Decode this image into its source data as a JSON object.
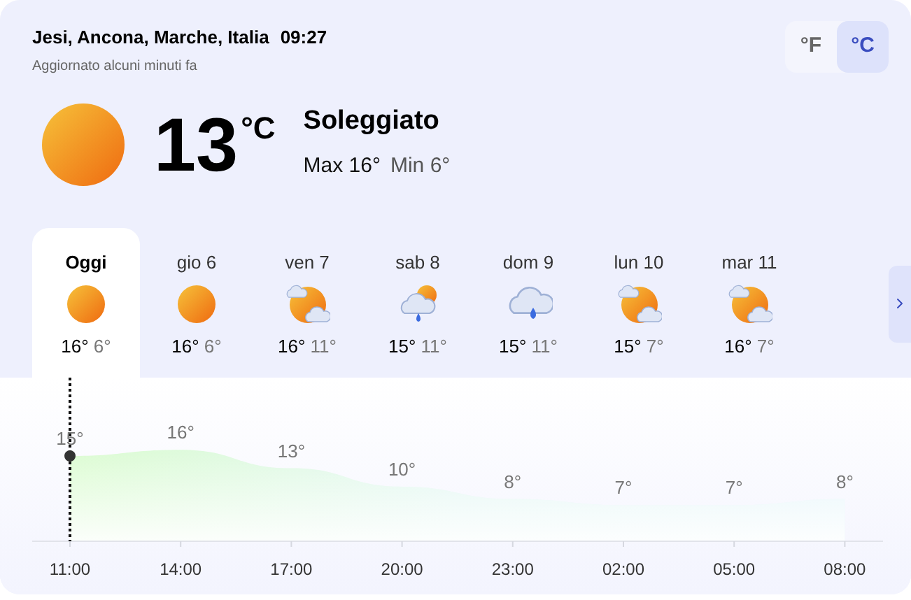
{
  "header": {
    "location": "Jesi, Ancona, Marche, Italia",
    "time": "09:27",
    "updated": "Aggiornato alcuni minuti fa"
  },
  "units": [
    {
      "label": "°F",
      "selected": false
    },
    {
      "label": "°C",
      "selected": true
    }
  ],
  "current": {
    "kind": "sun",
    "temperature": "13",
    "unit": "°C",
    "condition": "Soleggiato",
    "max_label": "Max",
    "max": "16°",
    "min_label": "Min",
    "min": "6°"
  },
  "days": [
    {
      "label": "Oggi",
      "kind": "sun",
      "high": "16°",
      "low": "6°",
      "selected": true
    },
    {
      "label": "gio 6",
      "kind": "sun",
      "high": "16°",
      "low": "6°",
      "selected": false
    },
    {
      "label": "ven 7",
      "kind": "sun-cloud",
      "high": "16°",
      "low": "11°",
      "selected": false
    },
    {
      "label": "sab 8",
      "kind": "rain-sun",
      "high": "15°",
      "low": "11°",
      "selected": false
    },
    {
      "label": "dom 9",
      "kind": "rain",
      "high": "15°",
      "low": "11°",
      "selected": false
    },
    {
      "label": "lun 10",
      "kind": "sun-cloud",
      "high": "15°",
      "low": "7°",
      "selected": false
    },
    {
      "label": "mar 11",
      "kind": "sun-cloud",
      "high": "16°",
      "low": "7°",
      "selected": false
    }
  ],
  "hourly": {
    "chart_data": {
      "type": "area",
      "categories": [
        "11:00",
        "14:00",
        "17:00",
        "20:00",
        "23:00",
        "02:00",
        "05:00",
        "08:00"
      ],
      "values": [
        15,
        16,
        13,
        10,
        8,
        7,
        7,
        8
      ],
      "value_labels": [
        "15°",
        "16°",
        "13°",
        "10°",
        "8°",
        "7°",
        "7°",
        "8°"
      ]
    }
  }
}
